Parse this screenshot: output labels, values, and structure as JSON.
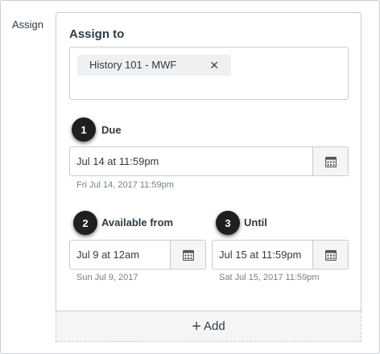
{
  "side_label": "Assign",
  "card": {
    "title": "Assign to",
    "assignee_tag": "History 101 - MWF",
    "remove_icon": "close-icon"
  },
  "due": {
    "step": "1",
    "label": "Due",
    "value": "Jul 14 at 11:59pm",
    "hint": "Fri Jul 14, 2017 11:59pm"
  },
  "available_from": {
    "step": "2",
    "label": "Available from",
    "value": "Jul 9 at 12am",
    "hint": "Sun Jul 9, 2017"
  },
  "until": {
    "step": "3",
    "label": "Until",
    "value": "Jul 15 at 11:59pm",
    "hint": "Sat Jul 15, 2017 11:59pm"
  },
  "add_button": {
    "icon": "plus-icon",
    "label": "Add"
  },
  "colors": {
    "text": "#2d3b45",
    "border": "#c7cdd1",
    "hint": "#73818c",
    "badge": "#1f1f1f",
    "tag_bg": "#eef0f2"
  }
}
